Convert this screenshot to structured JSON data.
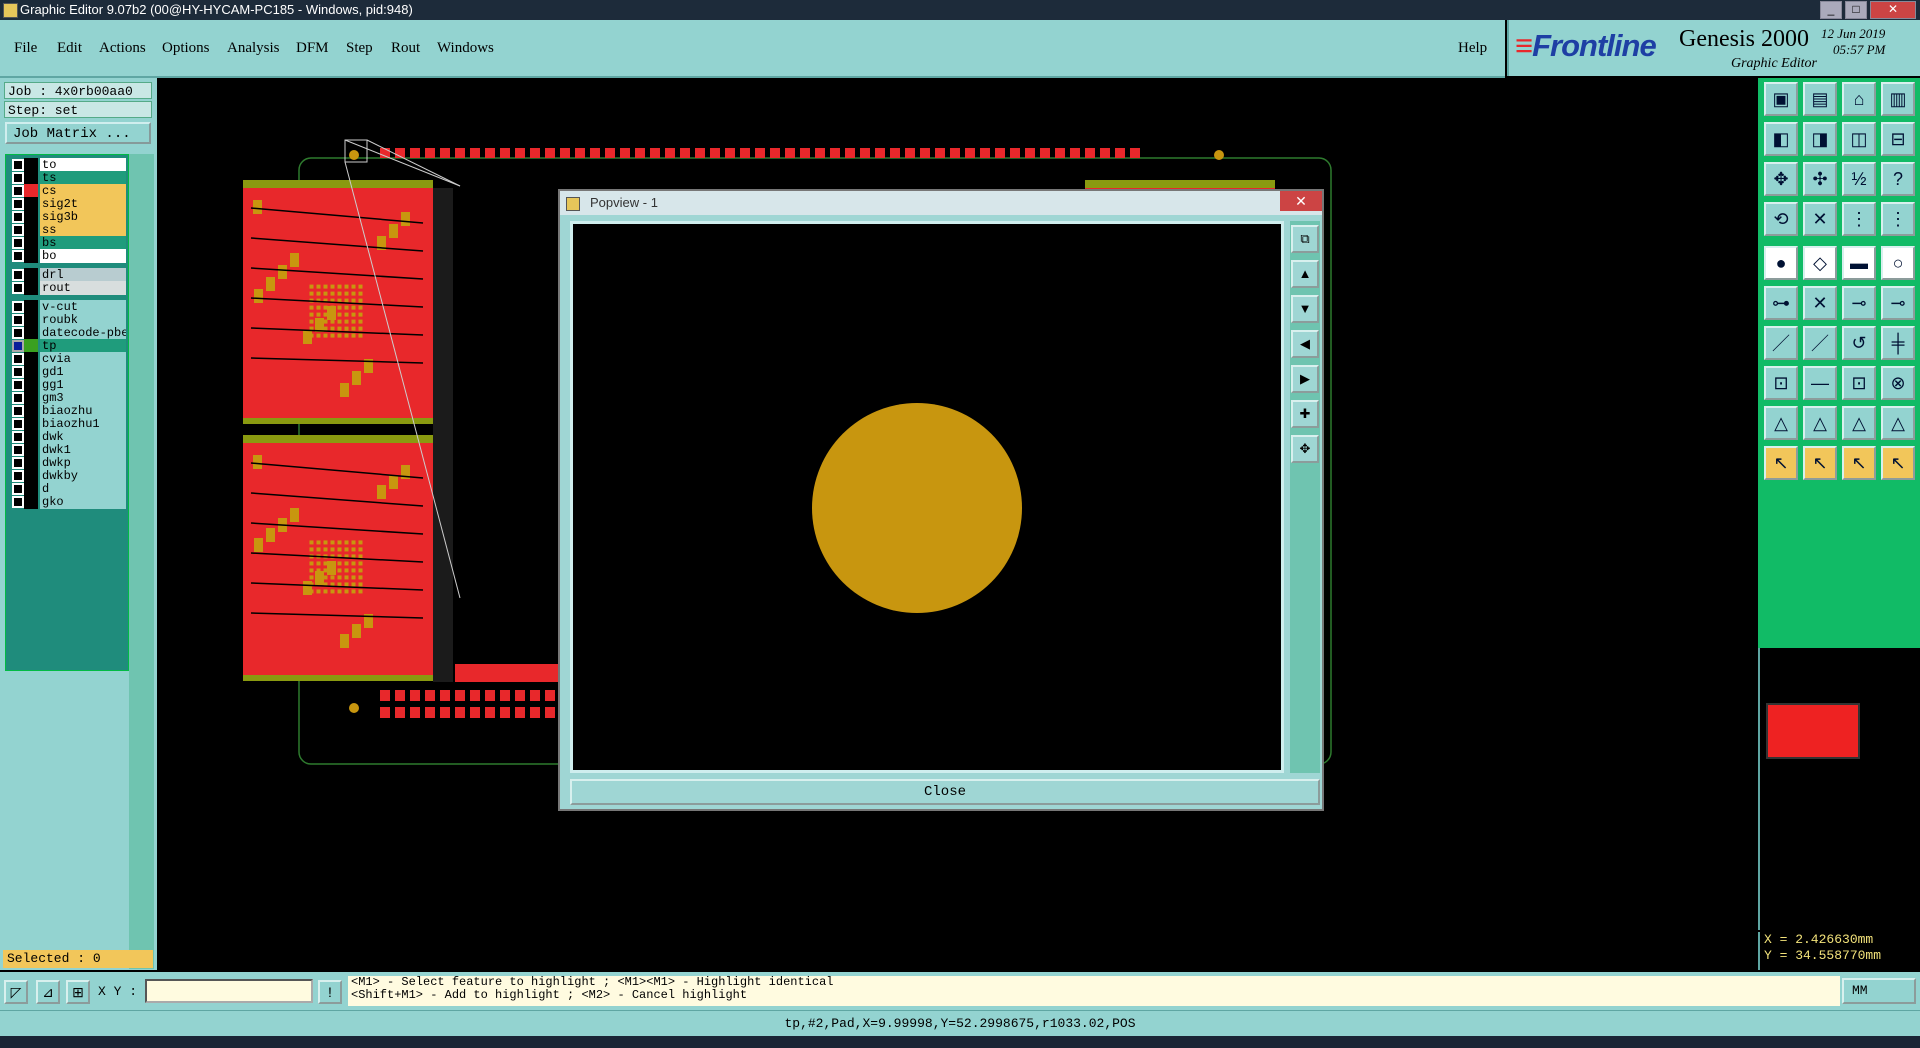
{
  "window": {
    "title": "Graphic Editor 9.07b2 (00@HY-HYCAM-PC185 - Windows, pid:948)",
    "controls": [
      "_",
      "□",
      "✕"
    ]
  },
  "menu": [
    "File",
    "Edit",
    "Actions",
    "Options",
    "Analysis",
    "DFM",
    "Step",
    "Rout",
    "Windows"
  ],
  "help": "Help",
  "brand": {
    "logo": "Frontline",
    "product": "Genesis 2000",
    "subtitle": "Graphic Editor",
    "date": "12 Jun 2019",
    "time": "05:57 PM"
  },
  "job": {
    "job_line": "Job : 4x0rb00aa0",
    "step_line": "Step: set",
    "matrix_button": "Job Matrix ..."
  },
  "layers": [
    {
      "name": "to",
      "color": "#ffffff",
      "swatch": "#000000"
    },
    {
      "name": "ts",
      "color": "#1f9c7c",
      "swatch": "#000000"
    },
    {
      "name": "cs",
      "color": "#f2c65a",
      "swatch": "#e8282b"
    },
    {
      "name": "sig2t",
      "color": "#f2c65a",
      "swatch": "#000000"
    },
    {
      "name": "sig3b",
      "color": "#f2c65a",
      "swatch": "#000000"
    },
    {
      "name": "ss",
      "color": "#f2c65a",
      "swatch": "#000000"
    },
    {
      "name": "bs",
      "color": "#1f9c7c",
      "swatch": "#000000"
    },
    {
      "name": "bo",
      "color": "#ffffff",
      "swatch": "#000000"
    },
    {
      "name": "drl",
      "color": "#b8ccd0",
      "swatch": "#000000"
    },
    {
      "name": "rout",
      "color": "#d8dede",
      "swatch": "#000000"
    },
    {
      "name": "v-cut",
      "color": "#93d3d0",
      "swatch": "#000000"
    },
    {
      "name": "roubk",
      "color": "#93d3d0",
      "swatch": "#000000"
    },
    {
      "name": "datecode-pbe",
      "color": "#93d3d0",
      "swatch": "#000000"
    },
    {
      "name": "tp",
      "color": "#1f9c7c",
      "swatch": "#3aa020",
      "selected": true
    },
    {
      "name": "cvia",
      "color": "#93d3d0",
      "swatch": "#000000"
    },
    {
      "name": "gd1",
      "color": "#93d3d0",
      "swatch": "#000000"
    },
    {
      "name": "gg1",
      "color": "#93d3d0",
      "swatch": "#000000"
    },
    {
      "name": "gm3",
      "color": "#93d3d0",
      "swatch": "#000000"
    },
    {
      "name": "biaozhu",
      "color": "#93d3d0",
      "swatch": "#000000"
    },
    {
      "name": "biaozhu1",
      "color": "#93d3d0",
      "swatch": "#000000"
    },
    {
      "name": "dwk",
      "color": "#93d3d0",
      "swatch": "#000000"
    },
    {
      "name": "dwk1",
      "color": "#93d3d0",
      "swatch": "#000000"
    },
    {
      "name": "dwkp",
      "color": "#93d3d0",
      "swatch": "#000000"
    },
    {
      "name": "dwkby",
      "color": "#93d3d0",
      "swatch": "#000000"
    },
    {
      "name": "d",
      "color": "#93d3d0",
      "swatch": "#000000"
    },
    {
      "name": "gko",
      "color": "#93d3d0",
      "swatch": "#000000"
    }
  ],
  "selected": "Selected : 0",
  "popview": {
    "title": "Popview - 1",
    "close_x": "✕",
    "close_button": "Close"
  },
  "bottom": {
    "xy_label": "X Y :",
    "xy_value": "",
    "hint_line1": "<M1> - Select feature to highlight ; <M1><M1> - Highlight identical",
    "hint_line2": "<Shift+M1> - Add to highlight ; <M2> - Cancel highlight",
    "units": "MM"
  },
  "coords": {
    "x": "X = 2.426630mm",
    "y": "Y = 34.558770mm"
  },
  "status": "tp,#2,Pad,X=9.99998,Y=52.2998675,r1033.02,POS",
  "colors": {
    "panel": "#93d3d0",
    "board_copper": "#e8282b",
    "pad_gold": "#c8960f",
    "yellow_row": "#f2c65a",
    "teal_row": "#1f9c7c"
  }
}
